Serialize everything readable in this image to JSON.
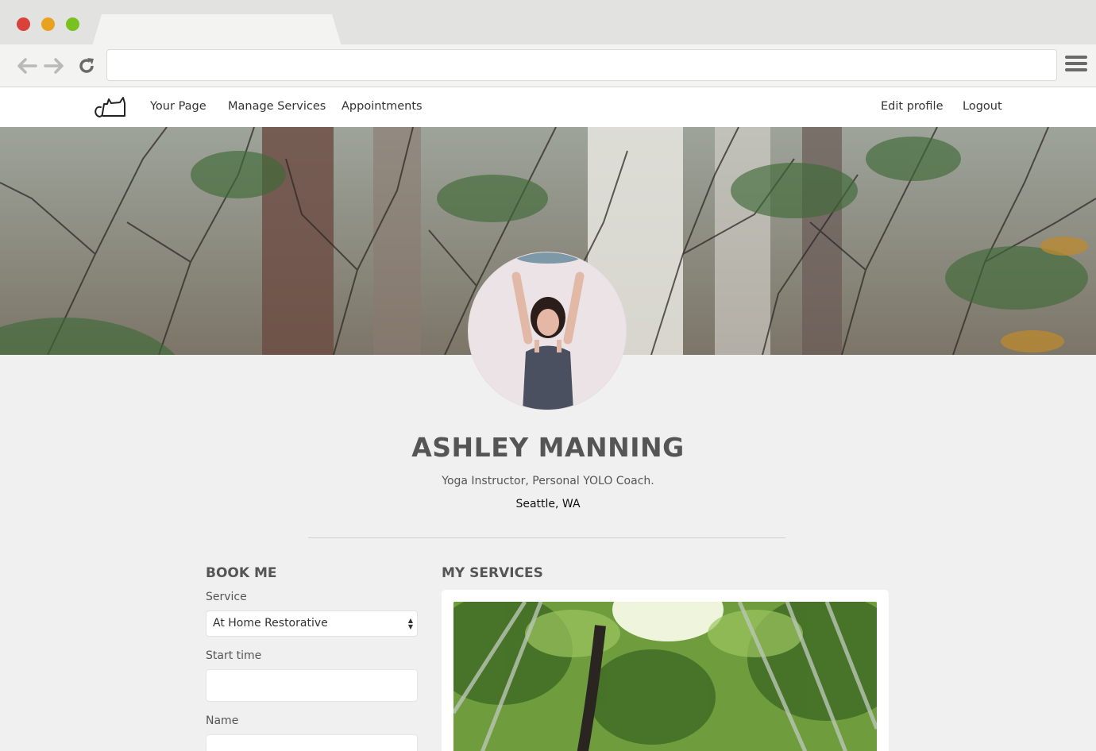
{
  "browser": {
    "address": ""
  },
  "nav": {
    "links": [
      "Your Page",
      "Manage Services",
      "Appointments"
    ],
    "right_links": [
      "Edit profile",
      "Logout"
    ]
  },
  "profile": {
    "name": "ASHLEY MANNING",
    "tagline": "Yoga Instructor, Personal YOLO Coach.",
    "location": "Seattle, WA"
  },
  "booking": {
    "title": "BOOK ME",
    "service_label": "Service",
    "service_value": "At Home Restorative",
    "start_time_label": "Start time",
    "start_time_value": "",
    "name_label": "Name",
    "name_value": ""
  },
  "services": {
    "title": "MY SERVICES"
  },
  "colors": {
    "page_bg": "#f0f0f0",
    "text": "#555555",
    "nav_bg": "#ffffff"
  }
}
